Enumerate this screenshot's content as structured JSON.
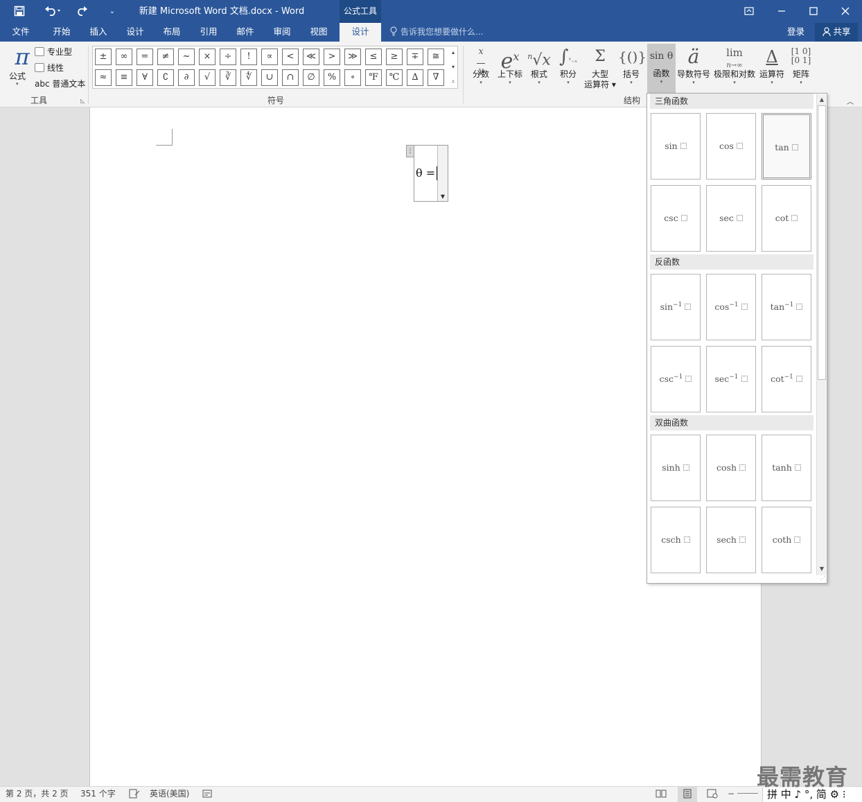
{
  "window": {
    "title": "新建 Microsoft Word 文档.docx - Word",
    "context_tab_title": "公式工具",
    "qat": {
      "save_icon": "save-icon",
      "undo_icon": "undo-icon",
      "redo_icon": "redo-icon",
      "customize_icon": "customize-icon"
    },
    "controls": {
      "ribbon_display": "ribbon-display-icon",
      "minimize": "minimize-icon",
      "maximize": "maximize-icon",
      "close": "close-icon"
    }
  },
  "tabs": [
    {
      "label": "文件"
    },
    {
      "label": "开始"
    },
    {
      "label": "插入"
    },
    {
      "label": "设计"
    },
    {
      "label": "布局"
    },
    {
      "label": "引用"
    },
    {
      "label": "邮件"
    },
    {
      "label": "审阅"
    },
    {
      "label": "视图"
    },
    {
      "label": "设计",
      "active": true
    }
  ],
  "tell_me": "告诉我您想要做什么...",
  "login": "登录",
  "share": "共享",
  "ribbon": {
    "tools": {
      "equation_label": "公式",
      "professional": "专业型",
      "linear": "线性",
      "normal_text": "abc 普通文本",
      "group_label": "工具"
    },
    "symbols": {
      "row1": [
        "±",
        "∞",
        "=",
        "≠",
        "~",
        "×",
        "÷",
        "!",
        "∝",
        "<",
        "≪",
        ">",
        "≫",
        "≤",
        "≥",
        "∓",
        "≅"
      ],
      "row2": [
        "≈",
        "≡",
        "∀",
        "∁",
        "∂",
        "√",
        "∛",
        "∜",
        "∪",
        "∩",
        "∅",
        "%",
        "∘",
        "℉",
        "℃",
        "∆",
        "∇"
      ],
      "group_label": "符号"
    },
    "structures": {
      "items": [
        {
          "icon_text": "x/y",
          "label": "分数"
        },
        {
          "icon_text": "eˣ",
          "label": "上下标"
        },
        {
          "icon_text": "ⁿ√x",
          "label": "根式"
        },
        {
          "icon_text": "∫",
          "label": "积分"
        },
        {
          "icon_text": "Σ",
          "label": "大型\n运算符"
        },
        {
          "icon_text": "{()}",
          "label": "括号"
        },
        {
          "icon_text": "sin θ",
          "label": "函数",
          "active": true
        },
        {
          "icon_text": "ä",
          "label": "导数符号"
        },
        {
          "icon_text": "lim",
          "label": "极限和对数"
        },
        {
          "icon_text": "Δ",
          "label": "运算符"
        },
        {
          "icon_text": "[10]",
          "label": "矩阵"
        }
      ],
      "group_label": "结构"
    }
  },
  "document": {
    "equation": "θ ="
  },
  "function_gallery": {
    "sections": [
      {
        "title": "三角函数",
        "items": [
          "sin",
          "cos",
          "tan",
          "csc",
          "sec",
          "cot"
        ]
      },
      {
        "title": "反函数",
        "items": [
          "sin",
          "cos",
          "tan",
          "csc",
          "sec",
          "cot"
        ],
        "superscript": "−1"
      },
      {
        "title": "双曲函数",
        "items": [
          "sinh",
          "cosh",
          "tanh",
          "csch",
          "sech",
          "coth"
        ]
      }
    ],
    "selected": "tan"
  },
  "status_bar": {
    "page": "第 2 页，共 2 页",
    "words": "351 个字",
    "language": "英语(美国)"
  },
  "watermark": "最需教育",
  "ime": "拼 中 ♪ °, 简 ⚙ ⁝"
}
